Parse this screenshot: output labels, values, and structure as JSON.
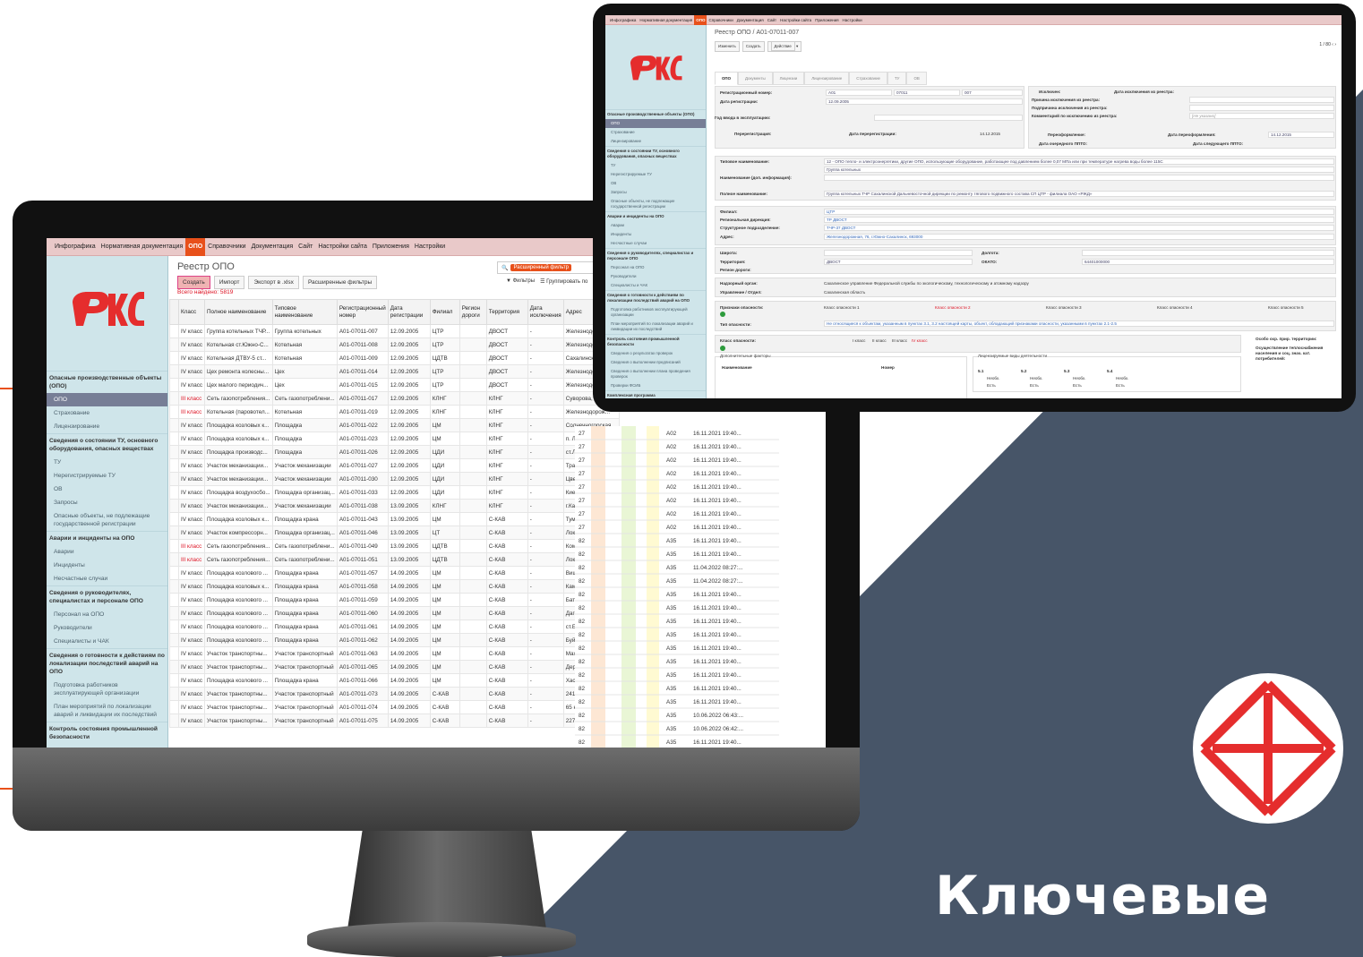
{
  "brand": {
    "headline": "Ключевые",
    "logo_text": "РЖД",
    "colors": {
      "accent": "#e8501a",
      "navy": "#475568",
      "red": "#e52d2d"
    }
  },
  "monitor_app": {
    "menu": [
      "Инфографика",
      "Нормативная документация",
      "ОПО",
      "Справочники",
      "Документация",
      "Сайт",
      "Настройки сайта",
      "Приложения",
      "Настройки"
    ],
    "active_menu": "ОПО",
    "title": "Реестр ОПО",
    "buttons": {
      "create": "Создать",
      "import": "Импорт",
      "export": "Экспорт в .xlsx",
      "filters": "Расширенные фильтры"
    },
    "found": "Всего найдено: 5819",
    "search_chip": "Расширенный фильтр",
    "tools": {
      "filters": "Фильтры",
      "group": "Группировать по"
    },
    "sidebar": [
      {
        "type": "group",
        "label": "Опасные производственные объекты (ОПО)"
      },
      {
        "type": "item",
        "label": "ОПО",
        "active": true
      },
      {
        "type": "item",
        "label": "Страхование"
      },
      {
        "type": "item",
        "label": "Лицензирование"
      },
      {
        "type": "group",
        "label": "Сведения о состоянии ТУ, основного оборудования, опасных веществах"
      },
      {
        "type": "item",
        "label": "ТУ"
      },
      {
        "type": "item",
        "label": "Нерегистрируемые ТУ"
      },
      {
        "type": "item",
        "label": "ОВ"
      },
      {
        "type": "item",
        "label": "Запросы"
      },
      {
        "type": "item",
        "label": "Опасные объекты, не подлежащие государственной регистрации"
      },
      {
        "type": "group",
        "label": "Аварии и инциденты на ОПО"
      },
      {
        "type": "item",
        "label": "Аварии"
      },
      {
        "type": "item",
        "label": "Инциденты"
      },
      {
        "type": "item",
        "label": "Несчастные случаи"
      },
      {
        "type": "group",
        "label": "Сведения о руководителях, специалистах и персонале ОПО"
      },
      {
        "type": "item",
        "label": "Персонал на ОПО"
      },
      {
        "type": "item",
        "label": "Руководители"
      },
      {
        "type": "item",
        "label": "Специалисты и ЧАК"
      },
      {
        "type": "group",
        "label": "Сведения о готовности к действиям по локализации последствий аварий на ОПО"
      },
      {
        "type": "item",
        "label": "Подготовка работников эксплуатирующей организации"
      },
      {
        "type": "item",
        "label": "План мероприятий по локализации аварий и ликвидации их последствий"
      },
      {
        "type": "group",
        "label": "Контроль состояния промышленной безопасности"
      },
      {
        "type": "item",
        "label": "Сведения о результатах проверок"
      }
    ],
    "columns": [
      "Класс",
      "Полное наименование",
      "Типовое наименование",
      "Регистрационный номер",
      "Дата регистрации",
      "Филиал",
      "Регион дороги",
      "Территория",
      "Дата исключения",
      "Адрес"
    ],
    "rows": [
      [
        "IV класс",
        "Группа котельных ТЧР...",
        "Группа котельных",
        "А01-07011-007",
        "12.09.2005",
        "ЦТР",
        "",
        "ДВОСТ",
        "-",
        "Железнодор..."
      ],
      [
        "IV класс",
        "Котельная ст.Южно-С...",
        "Котельная",
        "А01-07011-008",
        "12.09.2005",
        "ЦТР",
        "",
        "ДВОСТ",
        "-",
        "Железнодор..."
      ],
      [
        "IV класс",
        "Котельная ДТВУ-5 ст...",
        "Котельная",
        "А01-07011-009",
        "12.09.2005",
        "ЦДТВ",
        "",
        "ДВОСТ",
        "-",
        "Сахалинская..."
      ],
      [
        "IV класс",
        "Цех ремонта колесны...",
        "Цех",
        "А01-07011-014",
        "12.09.2005",
        "ЦТР",
        "",
        "ДВОСТ",
        "-",
        "Железнодор..."
      ],
      [
        "IV класс",
        "Цех малого периодич...",
        "Цех",
        "А01-07011-015",
        "12.09.2005",
        "ЦТР",
        "",
        "ДВОСТ",
        "-",
        "Железнодор..."
      ],
      [
        "III класс",
        "Сеть газопотребления...",
        "Сеть газопотреблени...",
        "А01-07011-017",
        "12.09.2005",
        "КЛНГ",
        "",
        "КЛНГ",
        "-",
        "Суворова, 1..."
      ],
      [
        "III класс",
        "Котельная (паровотел...",
        "Котельная",
        "А01-07011-019",
        "12.09.2005",
        "КЛНГ",
        "",
        "КЛНГ",
        "-",
        "Железнодорож..."
      ],
      [
        "IV класс",
        "Площадка козловых к...",
        "Площадка",
        "А01-07011-022",
        "12.09.2005",
        "ЦМ",
        "",
        "КЛНГ",
        "-",
        "Солнечногорская..."
      ],
      [
        "IV класс",
        "Площадка козловых к...",
        "Площадка",
        "А01-07011-023",
        "12.09.2005",
        "ЦМ",
        "",
        "КЛНГ",
        "-",
        "п. Луговое, 1, Че..."
      ],
      [
        "IV класс",
        "Площадка производс...",
        "Площадка",
        "А01-07011-026",
        "12.09.2005",
        "ЦДИ",
        "",
        "КЛНГ",
        "-",
        "ст.Луговое-Новое..."
      ],
      [
        "IV класс",
        "Участок механизации...",
        "Участок механизации",
        "А01-07011-027",
        "12.09.2005",
        "ЦДИ",
        "",
        "КЛНГ",
        "-",
        "Трамвайный, 53,..."
      ],
      [
        "IV класс",
        "Участок механизации...",
        "Участок механизации",
        "А01-07011-030",
        "12.09.2005",
        "ЦДИ",
        "",
        "КЛНГ",
        "-",
        "Цветочная, 3, г.К..."
      ],
      [
        "IV класс",
        "Площадка воздухосбо...",
        "Площадка организац...",
        "А01-07011-033",
        "12.09.2005",
        "ЦДИ",
        "",
        "КЛНГ",
        "-",
        "Киевская, 686, г...."
      ],
      [
        "IV класс",
        "Участок механизации...",
        "Участок механизации",
        "А01-07011-038",
        "13.09.2005",
        "КЛНГ",
        "",
        "КЛНГ",
        "-",
        "г.Калининград, с..."
      ],
      [
        "IV класс",
        "Площадка козловых к...",
        "Площадка крана",
        "А01-07011-043",
        "13.09.2005",
        "ЦМ",
        "",
        "С-КАВ",
        "-",
        "Туманяна, 53, Ки..."
      ],
      [
        "IV класс",
        "Участок компрессорн...",
        "Площадка организац...",
        "А01-07011-046",
        "13.09.2005",
        "ЦТ",
        "",
        "С-КАВ",
        "-",
        "Локомотивная, 1..."
      ],
      [
        "III класс",
        "Сеть газопотребления...",
        "Сеть газопотреблени...",
        "А01-07011-049",
        "13.09.2005",
        "ЦДТВ",
        "",
        "С-КАВ",
        "-",
        "Комарова, 3, г.М..."
      ],
      [
        "III класс",
        "Сеть газопотребления...",
        "Сеть газопотреблени...",
        "А01-07011-051",
        "13.09.2005",
        "ЦДТВ",
        "",
        "С-КАВ",
        "-",
        "Локомотивная, 1..."
      ],
      [
        "IV класс",
        "Площадка козлового ...",
        "Площадка крана",
        "А01-07011-057",
        "14.09.2005",
        "ЦМ",
        "",
        "С-КАВ",
        "-",
        "Вишневского, Ки..."
      ],
      [
        "IV класс",
        "Площадка козловых к...",
        "Площадка крана",
        "А01-07011-058",
        "14.09.2005",
        "ЦМ",
        "",
        "С-КАВ",
        "-",
        "Каммаева, Маха..."
      ],
      [
        "IV класс",
        "Площадка козлового ...",
        "Площадка крана",
        "А01-07011-059",
        "14.09.2005",
        "ЦМ",
        "",
        "С-КАВ",
        "-",
        "Батырая, Избербl..."
      ],
      [
        "IV класс",
        "Площадка козлового ...",
        "Площадка крана",
        "А01-07011-060",
        "14.09.2005",
        "ЦМ",
        "",
        "С-КАВ",
        "-",
        "Дагестанские Ог..."
      ],
      [
        "IV класс",
        "Площадка козлового ...",
        "Площадка крана",
        "А01-07011-061",
        "14.09.2005",
        "ЦМ",
        "",
        "С-КАВ",
        "-",
        "ст.Белиджи, 368..."
      ],
      [
        "IV класс",
        "Площадка козлового ...",
        "Площадка крана",
        "А01-07011-062",
        "14.09.2005",
        "ЦМ",
        "",
        "С-КАВ",
        "-",
        "Буйнакск, 368220"
      ],
      [
        "IV класс",
        "Участок транспортны...",
        "Участок транспортный",
        "А01-07011-063",
        "14.09.2005",
        "ЦМ",
        "",
        "С-КАВ",
        "-",
        "Махачкала, 3670..."
      ],
      [
        "IV класс",
        "Участок транспортны...",
        "Участок транспортный",
        "А01-07011-065",
        "14.09.2005",
        "ЦМ",
        "",
        "С-КАВ",
        "-",
        "Дербент, 368608"
      ],
      [
        "IV класс",
        "Площадка козлового ...",
        "Площадка крана",
        "А01-07011-066",
        "14.09.2005",
        "ЦМ",
        "",
        "С-КАВ",
        "-",
        "Хасавюрт, 368006"
      ],
      [
        "IV класс",
        "Участок транспортны...",
        "Участок транспортный",
        "А01-07011-073",
        "14.09.2005",
        "С-КАВ",
        "",
        "С-КАВ",
        "-",
        "2416 км пк 5, г.Д..."
      ],
      [
        "IV класс",
        "Участок транспортны...",
        "Участок транспортный",
        "А01-07011-074",
        "14.09.2005",
        "С-КАВ",
        "",
        "С-КАВ",
        "-",
        "65 км пк 6, г.Кизл..."
      ],
      [
        "IV класс",
        "Участок транспортны...",
        "Участок транспортный",
        "А01-07011-075",
        "14.09.2005",
        "С-КАВ",
        "",
        "С-КАВ",
        "-",
        "2279 км, г.Махач..."
      ]
    ],
    "right_rows": [
      [
        "27",
        "А02",
        "16.11.2021 19:40..."
      ],
      [
        "27",
        "А02",
        "16.11.2021 19:40..."
      ],
      [
        "27",
        "А02",
        "16.11.2021 19:40..."
      ],
      [
        "27",
        "А02",
        "16.11.2021 19:40..."
      ],
      [
        "27",
        "А02",
        "16.11.2021 19:40..."
      ],
      [
        "27",
        "А02",
        "16.11.2021 19:40..."
      ],
      [
        "27",
        "А02",
        "16.11.2021 19:40..."
      ],
      [
        "27",
        "А02",
        "16.11.2021 19:40..."
      ],
      [
        "82",
        "А35",
        "16.11.2021 19:40..."
      ],
      [
        "82",
        "А35",
        "16.11.2021 19:40..."
      ],
      [
        "82",
        "А35",
        "11.04.2022 08:27:..."
      ],
      [
        "82",
        "А35",
        "11.04.2022 08:27:..."
      ],
      [
        "82",
        "А35",
        "16.11.2021 19:40..."
      ],
      [
        "82",
        "А35",
        "16.11.2021 19:40..."
      ],
      [
        "82",
        "А35",
        "16.11.2021 19:40..."
      ],
      [
        "82",
        "А35",
        "16.11.2021 19:40..."
      ],
      [
        "82",
        "А35",
        "16.11.2021 19:40..."
      ],
      [
        "82",
        "А35",
        "16.11.2021 19:40..."
      ],
      [
        "82",
        "А35",
        "16.11.2021 19:40..."
      ],
      [
        "82",
        "А35",
        "16.11.2021 19:40..."
      ],
      [
        "82",
        "А35",
        "16.11.2021 19:40..."
      ],
      [
        "82",
        "А35",
        "10.06.2022 06:43:..."
      ],
      [
        "82",
        "А35",
        "10.06.2022 06:42:..."
      ],
      [
        "82",
        "А35",
        "16.11.2021 19:40..."
      ]
    ]
  },
  "tablet_app": {
    "menu": [
      "Инфографика",
      "Нормативная документация",
      "ОПО",
      "Справочники",
      "Документация",
      "Сайт",
      "Настройки сайта",
      "Приложения",
      "Настройки"
    ],
    "active_menu": "ОПО",
    "breadcrumb": "Реестр ОПО / А01-07011-007",
    "buttons": {
      "edit": "Изменить",
      "create": "Создать",
      "action": "Действие"
    },
    "pager": "1 / 80",
    "tabs": [
      "ОПО",
      "Документы",
      "Лицензии",
      "Лицензирование",
      "Страхование",
      "ТУ",
      "ОВ"
    ],
    "sidebar": [
      {
        "type": "group",
        "label": "Опасные производственные объекты (ОПО)"
      },
      {
        "type": "item",
        "label": "ОПО",
        "active": true
      },
      {
        "type": "item",
        "label": "Страхование"
      },
      {
        "type": "item",
        "label": "Лицензирование"
      },
      {
        "type": "group",
        "label": "Сведения о состоянии ТУ, основного оборудования, опасных веществах"
      },
      {
        "type": "item",
        "label": "ТУ"
      },
      {
        "type": "item",
        "label": "Нерегистрируемые ТУ"
      },
      {
        "type": "item",
        "label": "ОВ"
      },
      {
        "type": "item",
        "label": "Запросы"
      },
      {
        "type": "item",
        "label": "Опасные объекты, не подлежащие государственной регистрации"
      },
      {
        "type": "group",
        "label": "Аварии и инциденты на ОПО"
      },
      {
        "type": "item",
        "label": "Аварии"
      },
      {
        "type": "item",
        "label": "Инциденты"
      },
      {
        "type": "item",
        "label": "Несчастные случаи"
      },
      {
        "type": "group",
        "label": "Сведения о руководителях, специалистах и персонале ОПО"
      },
      {
        "type": "item",
        "label": "Персонал на ОПО"
      },
      {
        "type": "item",
        "label": "Руководители"
      },
      {
        "type": "item",
        "label": "Специалисты и ЧАК"
      },
      {
        "type": "group",
        "label": "Сведения о готовности к действиям по локализации последствий аварий на ОПО"
      },
      {
        "type": "item",
        "label": "Подготовка работников эксплуатирующей организации"
      },
      {
        "type": "item",
        "label": "План мероприятий по локализации аварий и ликвидации их последствий"
      },
      {
        "type": "group",
        "label": "Контроль состояния промышленной безопасности"
      },
      {
        "type": "item",
        "label": "Сведения о результатах проверок"
      },
      {
        "type": "item",
        "label": "Сведения о выполнении предписаний"
      },
      {
        "type": "item",
        "label": "Сведения о выполнении плана проведения проверок"
      },
      {
        "type": "item",
        "label": "Проверки ФСИБ"
      },
      {
        "type": "group",
        "label": "Комплексная программа"
      },
      {
        "type": "item",
        "label": "Ведение данных"
      }
    ],
    "form": {
      "reg_number_label": "Регистрационный номер:",
      "reg_number_parts": [
        "А01",
        "07011",
        "007"
      ],
      "reg_date_label": "Дата регистрации:",
      "reg_date": "12.09.2005",
      "commission_label": "Год ввода в эксплуатацию:",
      "rereg_label": "Перерегистрация:",
      "rereg_date_label": "Дата перерегистрации:",
      "rereg_date": "14.12.2015",
      "excluded_label": "Исключен:",
      "excl_date_label": "Дата исключения из реестра:",
      "excl_reason_label": "Причина исключения из реестра:",
      "excl_subreason_label": "Подпричина исключения из реестра:",
      "excl_comment_label": "Комментарий по исключению из реестра:",
      "excl_comment": "[Не указано]",
      "reform_label": "Переоформление:",
      "reform_date_label": "Дата переоформления:",
      "reform_date": "14.12.2015",
      "next_ppto_label": "Дата очередного ППТО:",
      "next_ppto2_label": "Дата следующего ППТО:",
      "type_name_label": "Типовое наименование:",
      "type_name": "12 - ОПО тепло- и электроэнергетики, другие ОПО, использующие оборудование, работающее под давлением более 0,07 МПа или при температуре нагрева воды более 115С",
      "type_name_2": "Группа котельных",
      "type_name_extra_label": "Наименование (доп. информация):",
      "full_name_label": "Полное наименование:",
      "full_name": "Группа котельных ТЧР Сахалинской Дальневосточной дирекции по ремонту тягового подвижного состава СП ЦТР - филиала ОАО «РЖД»",
      "branch_label": "Филиал:",
      "branch": "ЦТР",
      "regional_label": "Региональная дирекция:",
      "regional": "ТР ДВОСТ",
      "struct_label": "Структурное подразделение:",
      "struct": "ТЧР-37 ДВОСТ",
      "address_label": "Адрес:",
      "address": "Железнодорожная, 76, г.Южно-Сахалинск, 693000",
      "lat_label": "Широта:",
      "lon_label": "Долгота:",
      "territory_label": "Территория:",
      "territory": "ДВОСТ",
      "okato_label": "ОКАТО:",
      "okato": "64401000000",
      "region_label": "Регион дороги:",
      "supervisor_label": "Надзорный орган:",
      "supervisor": "Сахалинское управление Федеральной службы по экологическому, технологическому и атомному надзору",
      "dept_label": "Управление / Отдел:",
      "dept": "Сахалинская область",
      "signs_label": "Признаки опасности:",
      "hazard_classes": [
        "Класс опасности 1",
        "Класс опасности 2",
        "Класс опасности 3",
        "Класс опасности 4",
        "Класс опасности 5"
      ],
      "hazard_type_label": "Тип опасности:",
      "hazard_type": "Не относящиеся к объектам, указанным в пунктах 3.1, 3.2 настоящей карты, объект, обладающий признаками опасности, указанными в пунктах 2.1-2.5",
      "danger_class_label": "Класс опасности:",
      "danger_classes": [
        "I класс",
        "II класс",
        "III класс",
        "IV класс"
      ],
      "extra_factors_label": "Дополнительные факторы",
      "extra_cols": [
        "Наименование",
        "Номер"
      ],
      "licensed_label": "Лицензируемые виды деятельности",
      "lic_cols": [
        "5.1",
        "5.2",
        "5.3",
        "5.4"
      ],
      "lic_need": "Необх.",
      "lic_have": "Есть",
      "special_terr": "Особо охр. прир. территории:",
      "heat_supply": "Осуществление теплоснабжения населения и соц. знач. кат. потребителей:"
    }
  }
}
